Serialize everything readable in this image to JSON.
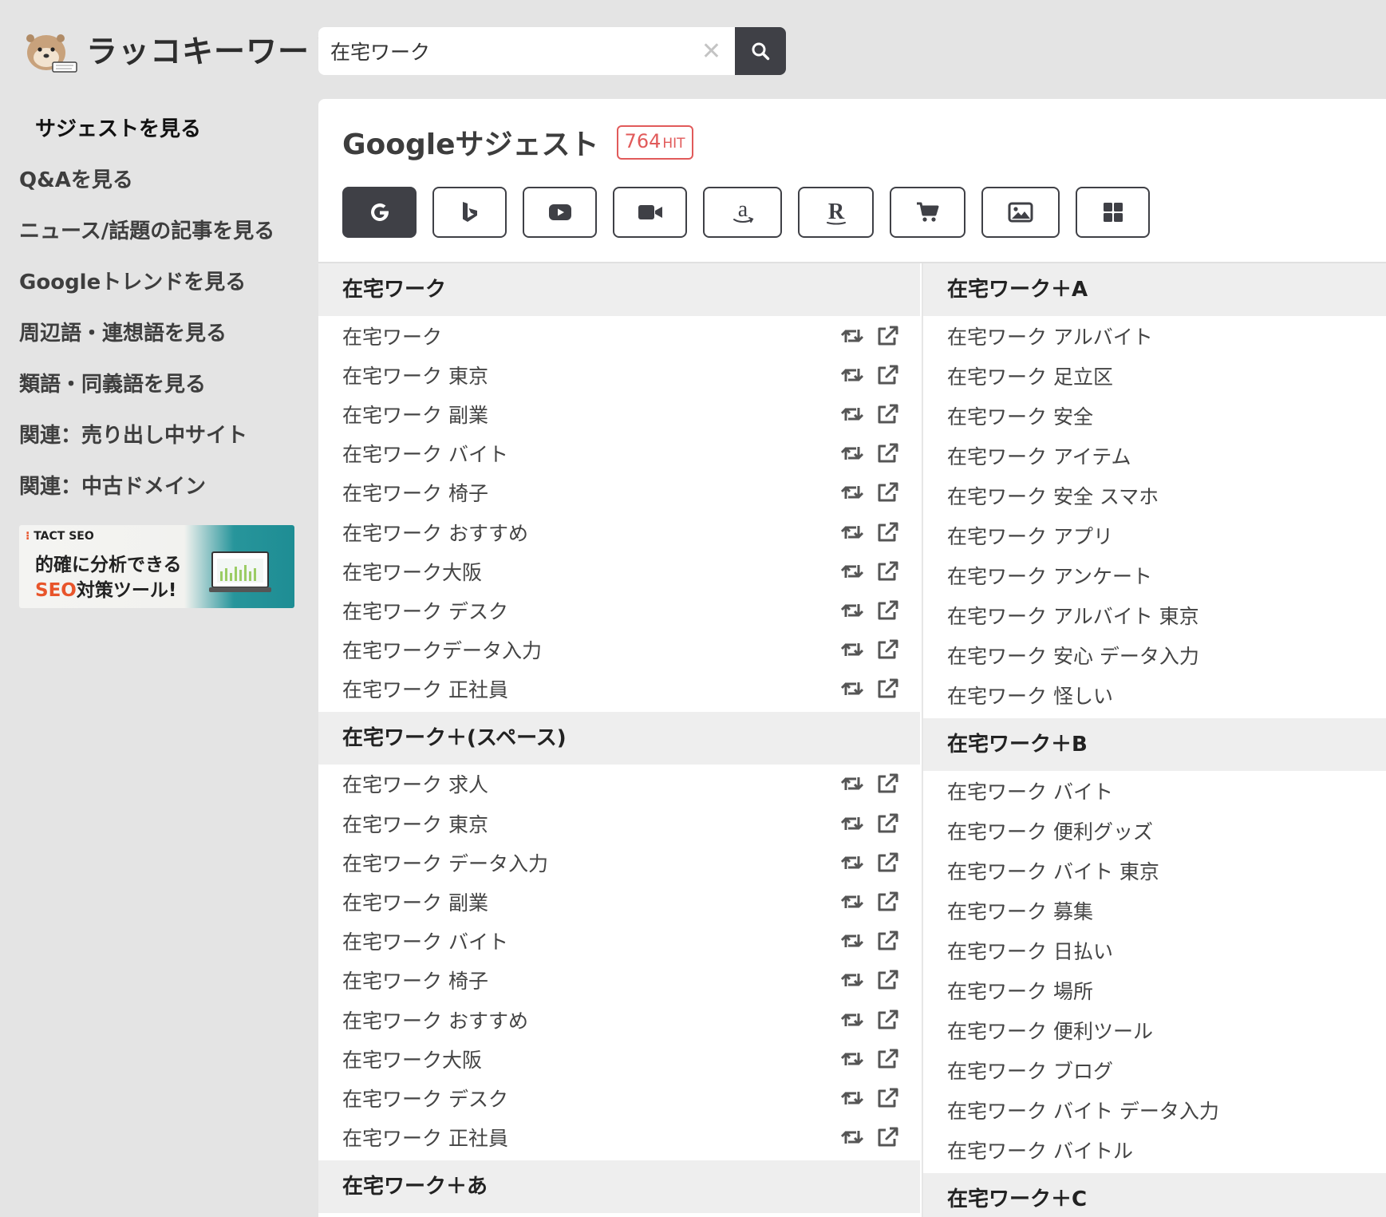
{
  "app": {
    "logo_text": "ラッコキーワード"
  },
  "search": {
    "value": "在宅ワーク",
    "placeholder": ""
  },
  "sidebar": {
    "items": [
      {
        "label": "サジェストを見る",
        "active": true
      },
      {
        "label": "Q&Aを見る"
      },
      {
        "label": "ニュース/話題の記事を見る"
      },
      {
        "label": "Googleトレンドを見る"
      },
      {
        "label": "周辺語・連想語を見る"
      },
      {
        "label": "類語・同義語を見る"
      },
      {
        "label": "関連：売り出し中サイト"
      },
      {
        "label": "関連：中古ドメイン"
      }
    ],
    "banner": {
      "brand": "TACT SEO",
      "line1": "的確に分析できる",
      "line2_highlight": "SEO",
      "line2_rest": "対策ツール!"
    }
  },
  "main": {
    "title": "Googleサジェスト",
    "hit_count": "764",
    "hit_unit": "HIT",
    "engines": [
      {
        "name": "google",
        "active": true
      },
      {
        "name": "bing"
      },
      {
        "name": "youtube"
      },
      {
        "name": "video"
      },
      {
        "name": "amazon"
      },
      {
        "name": "rakuten"
      },
      {
        "name": "shopping"
      },
      {
        "name": "image"
      },
      {
        "name": "all"
      }
    ]
  },
  "groups_left": [
    {
      "title": "在宅ワーク",
      "items": [
        "在宅ワーク",
        "在宅ワーク 東京",
        "在宅ワーク 副業",
        "在宅ワーク バイト",
        "在宅ワーク 椅子",
        "在宅ワーク おすすめ",
        "在宅ワーク大阪",
        "在宅ワーク デスク",
        "在宅ワークデータ入力",
        "在宅ワーク 正社員"
      ]
    },
    {
      "title": "在宅ワーク＋(スペース)",
      "items": [
        "在宅ワーク 求人",
        "在宅ワーク 東京",
        "在宅ワーク データ入力",
        "在宅ワーク 副業",
        "在宅ワーク バイト",
        "在宅ワーク 椅子",
        "在宅ワーク おすすめ",
        "在宅ワーク大阪",
        "在宅ワーク デスク",
        "在宅ワーク 正社員"
      ]
    },
    {
      "title": "在宅ワーク＋あ",
      "items": []
    }
  ],
  "groups_right": [
    {
      "title": "在宅ワーク＋A",
      "items": [
        "在宅ワーク アルバイト",
        "在宅ワーク 足立区",
        "在宅ワーク 安全",
        "在宅ワーク アイテム",
        "在宅ワーク 安全 スマホ",
        "在宅ワーク アプリ",
        "在宅ワーク アンケート",
        "在宅ワーク アルバイト 東京",
        "在宅ワーク 安心 データ入力",
        "在宅ワーク 怪しい"
      ]
    },
    {
      "title": "在宅ワーク＋B",
      "items": [
        "在宅ワーク バイト",
        "在宅ワーク 便利グッズ",
        "在宅ワーク バイト 東京",
        "在宅ワーク 募集",
        "在宅ワーク 日払い",
        "在宅ワーク 場所",
        "在宅ワーク 便利ツール",
        "在宅ワーク ブログ",
        "在宅ワーク バイト データ入力",
        "在宅ワーク バイトル"
      ]
    },
    {
      "title": "在宅ワーク＋C",
      "items": []
    }
  ],
  "colors": {
    "accent_dark": "#3f4046",
    "hit_red": "#e15a5a",
    "banner_teal": "#1e8d94",
    "banner_orange": "#e8552b"
  }
}
